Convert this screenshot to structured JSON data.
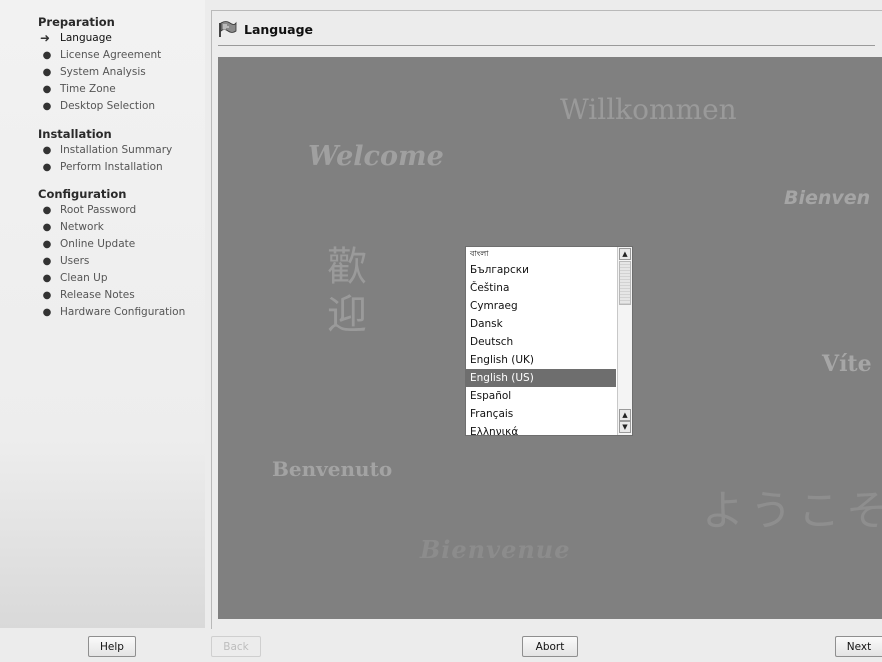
{
  "sidebar": {
    "sections": [
      {
        "title": "Preparation",
        "steps": [
          {
            "label": "Language",
            "current": true
          },
          {
            "label": "License Agreement"
          },
          {
            "label": "System Analysis"
          },
          {
            "label": "Time Zone"
          },
          {
            "label": "Desktop Selection"
          }
        ]
      },
      {
        "title": "Installation",
        "steps": [
          {
            "label": "Installation Summary"
          },
          {
            "label": "Perform Installation"
          }
        ]
      },
      {
        "title": "Configuration",
        "steps": [
          {
            "label": "Root Password"
          },
          {
            "label": "Network"
          },
          {
            "label": "Online Update"
          },
          {
            "label": "Users"
          },
          {
            "label": "Clean Up"
          },
          {
            "label": "Release Notes"
          },
          {
            "label": "Hardware Configuration"
          }
        ]
      }
    ],
    "markers": {
      "current": "➜",
      "pending": "●"
    }
  },
  "header": {
    "title": "Language",
    "icon": "language-flag-icon"
  },
  "welcome": {
    "welcome": "Welcome",
    "willkommen": "Willkommen",
    "bienvenido": "Bienven",
    "kanji_1": "歡",
    "kanji_2": "迎",
    "vitejte": "Víte",
    "benvenuto": "Benvenuto",
    "youkoso": "ようこそ",
    "bienvenue": "Bienvenue"
  },
  "language_list": {
    "items": [
      "বাংলা",
      "Български",
      "Čeština",
      "Cymraeg",
      "Dansk",
      "Deutsch",
      "English (UK)",
      "English (US)",
      "Español",
      "Français",
      "Ελληνικά"
    ],
    "selected_index": 7
  },
  "buttons": {
    "help": "Help",
    "back": "Back",
    "abort": "Abort",
    "next": "Next"
  },
  "colors": {
    "panel_bg": "#808080",
    "selection": "#6e6e6e",
    "window_bg": "#ececec"
  }
}
